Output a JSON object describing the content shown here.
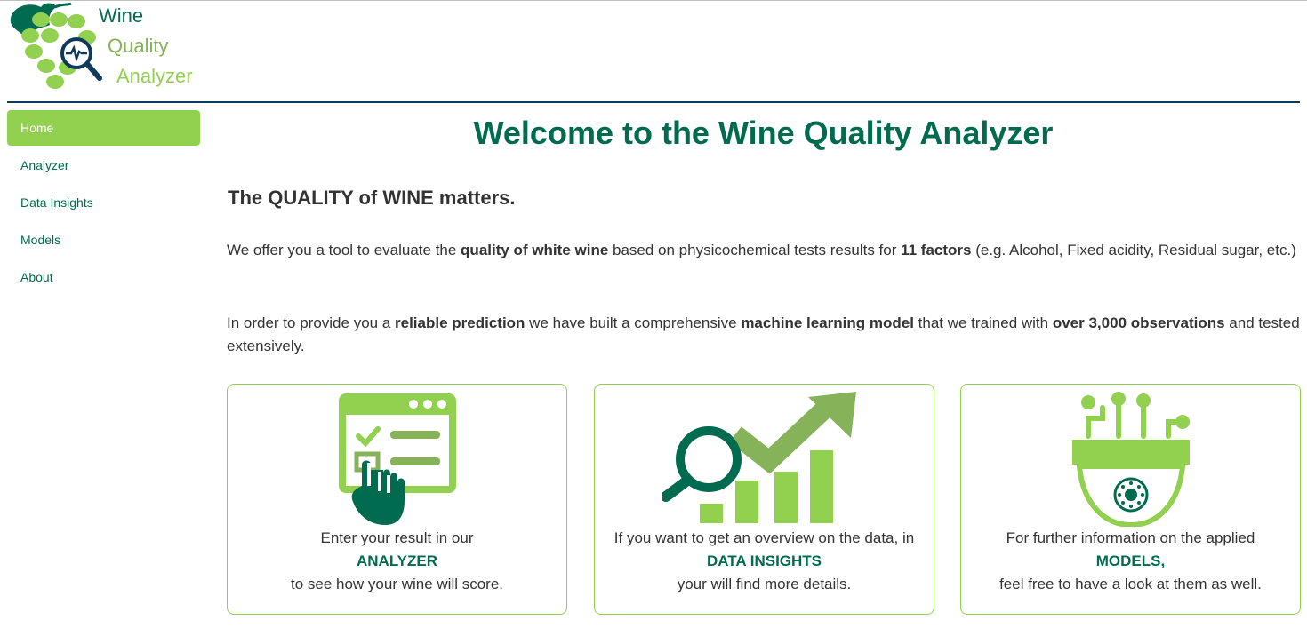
{
  "brand": {
    "line1": "Wine",
    "line2": "Quality",
    "line3": "Analyzer",
    "colors": {
      "dark_green": "#006b4f",
      "light_green": "#92d050",
      "olive": "#86b25a",
      "navy": "#0f3a5a"
    }
  },
  "sidebar": {
    "items": [
      {
        "label": "Home",
        "active": true
      },
      {
        "label": "Analyzer",
        "active": false
      },
      {
        "label": "Data Insights",
        "active": false
      },
      {
        "label": "Models",
        "active": false
      },
      {
        "label": "About",
        "active": false
      }
    ]
  },
  "main": {
    "title": "Welcome to the Wine Quality Analyzer",
    "subtitle": "The QUALITY of WINE matters.",
    "p1": {
      "t1": "We offer you a tool to evaluate the ",
      "b1": "quality of white wine",
      "t2": " based on physicochemical tests results for ",
      "b2": "11 factors",
      "t3": " (e.g. Alcohol, Fixed acidity, Residual sugar, etc.)"
    },
    "p2": {
      "t1": "In order to provide you a ",
      "b1": "reliable prediction",
      "t2": " we have built a comprehensive ",
      "b2": "machine learning model",
      "t3": " that we trained with ",
      "b3": "over 3,000 observations",
      "t4": " and tested extensively."
    },
    "cards": [
      {
        "icon": "analyzer-form-icon",
        "line1": "Enter your result in our",
        "highlight": "ANALYZER",
        "line2": "to see how your wine will score."
      },
      {
        "icon": "data-insights-chart-icon",
        "line1": "If you want to get an overview on the data, in",
        "highlight": "DATA INSIGHTS",
        "line2": "your will find more details."
      },
      {
        "icon": "models-chip-icon",
        "line1": "For further information on the applied",
        "highlight": "MODELS,",
        "line2": "feel free to have a look at them as well."
      }
    ]
  }
}
